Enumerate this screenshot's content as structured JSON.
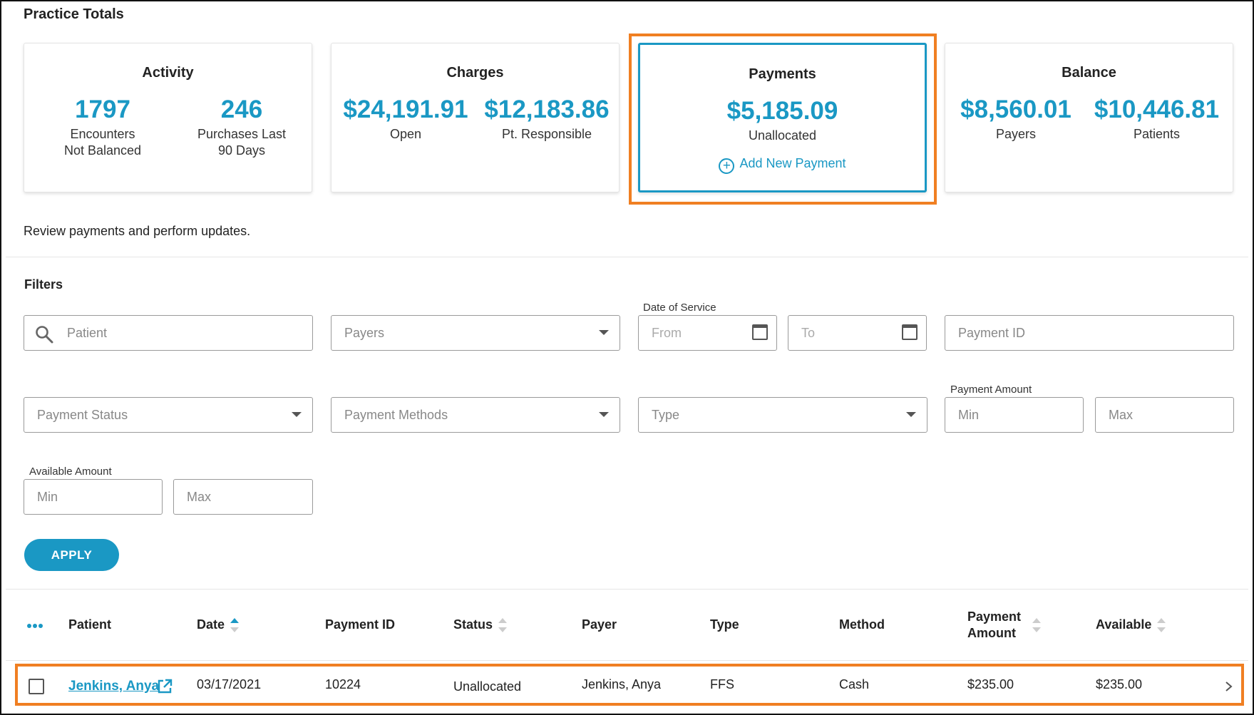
{
  "practice_totals": {
    "title": "Practice Totals",
    "cards": [
      {
        "title": "Activity",
        "metrics": [
          {
            "value": "1797",
            "label": "Encounters\nNot Balanced"
          },
          {
            "value": "246",
            "label": "Purchases Last\n90 Days"
          }
        ]
      },
      {
        "title": "Charges",
        "metrics": [
          {
            "value": "$24,191.91",
            "label": "Open"
          },
          {
            "value": "$12,183.86",
            "label": "Pt. Responsible"
          }
        ]
      },
      {
        "title": "Payments",
        "metrics": [
          {
            "value": "$5,185.09",
            "label": "Unallocated"
          }
        ],
        "action": "Add New Payment"
      },
      {
        "title": "Balance",
        "metrics": [
          {
            "value": "$8,560.01",
            "label": "Payers"
          },
          {
            "value": "$10,446.81",
            "label": "Patients"
          }
        ]
      }
    ]
  },
  "description": "Review payments and perform updates.",
  "filters": {
    "title": "Filters",
    "patient_placeholder": "Patient",
    "payers_placeholder": "Payers",
    "date_of_service_label": "Date of Service",
    "from_placeholder": "From",
    "to_placeholder": "To",
    "payment_id_placeholder": "Payment ID",
    "payment_status_placeholder": "Payment Status",
    "payment_methods_placeholder": "Payment Methods",
    "type_placeholder": "Type",
    "payment_amount_label": "Payment Amount",
    "available_amount_label": "Available Amount",
    "min_placeholder": "Min",
    "max_placeholder": "Max",
    "apply_label": "APPLY"
  },
  "table": {
    "columns": [
      "Patient",
      "Date",
      "Payment ID",
      "Status",
      "Payer",
      "Type",
      "Method",
      "Payment Amount",
      "Available"
    ],
    "rows": [
      {
        "patient": "Jenkins, Anya",
        "date": "03/17/2021",
        "payment_id": "10224",
        "status": "Unallocated",
        "payer": "Jenkins, Anya",
        "type": "FFS",
        "method": "Cash",
        "payment_amount": "$235.00",
        "available": "$235.00"
      }
    ]
  },
  "colors": {
    "accent": "#1a98c4",
    "highlight": "#f07f22"
  },
  "icons": [
    "search-icon",
    "dropdown-caret-icon",
    "calendar-icon",
    "add-circle-icon",
    "sort-icon",
    "more-options-icon",
    "external-link-icon",
    "chevron-right-icon"
  ]
}
